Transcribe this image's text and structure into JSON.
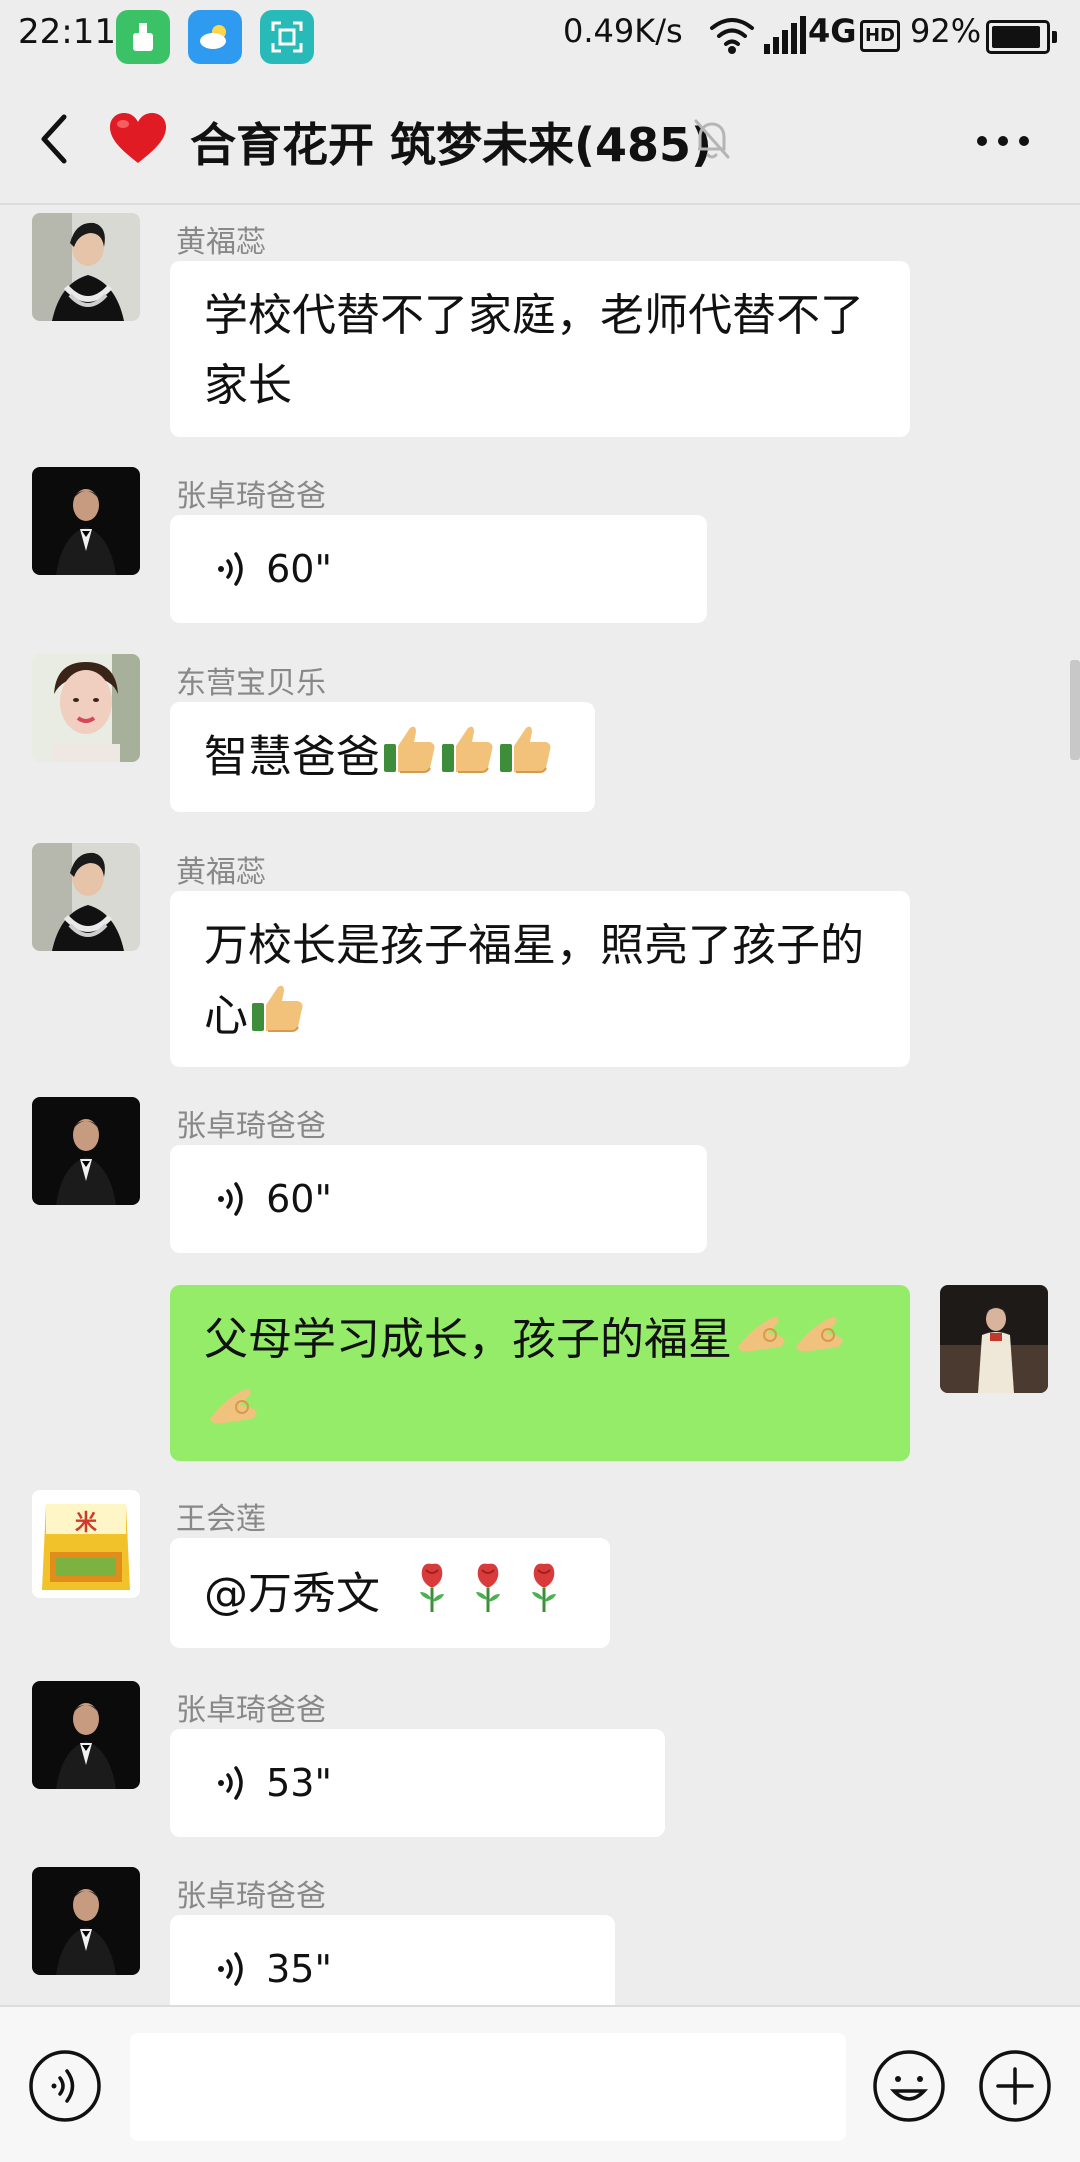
{
  "status_bar": {
    "time": "22:11",
    "net_speed": "0.49K/s",
    "network": "4G",
    "hd": "HD",
    "battery": "92%",
    "battery_level": 0.92,
    "icons": [
      "cleaner-app-icon",
      "weather-app-icon",
      "scanner-app-icon",
      "wifi-icon",
      "signal-icon",
      "battery-icon"
    ]
  },
  "header": {
    "title": "合育花开 筑梦未来(485)",
    "icons": [
      "back-arrow-icon",
      "heart-icon",
      "mute-bell-icon",
      "more-icon"
    ]
  },
  "messages": [
    {
      "sender": "黄福蕊",
      "type": "text",
      "lines": [
        "学校代替不了家庭，老师代替不了",
        "家长"
      ]
    },
    {
      "sender": "张卓琦爸爸",
      "type": "voice",
      "duration": "60\""
    },
    {
      "sender": "东营宝贝乐",
      "type": "text",
      "lines": [
        "智慧爸爸"
      ],
      "emoji": "thumbs-up-icon"
    },
    {
      "sender": "黄福蕊",
      "type": "text",
      "lines": [
        "万校长是孩子福星，照亮了孩子的",
        "心"
      ],
      "emoji": "thumbs-up-icon"
    },
    {
      "sender": "张卓琦爸爸",
      "type": "voice",
      "duration": "60\""
    },
    {
      "sender": "",
      "type": "text",
      "self": true,
      "lines": [
        "父母学习成长，孩子的福星"
      ],
      "emoji": "ok-hand-icon"
    },
    {
      "sender": "王会莲",
      "type": "text",
      "lines": [
        "@万秀文"
      ],
      "emoji": "rose-icon"
    },
    {
      "sender": "张卓琦爸爸",
      "type": "voice",
      "duration": "53\""
    },
    {
      "sender": "张卓琦爸爸",
      "type": "voice",
      "duration": "35\""
    }
  ],
  "input_bar": {
    "placeholder": "",
    "icons": [
      "voice-toggle-icon",
      "emoji-icon",
      "plus-icon"
    ]
  },
  "colors": {
    "background": "#ededed",
    "bubble_other": "#ffffff",
    "bubble_self": "#95ec69",
    "sender_name": "#888888"
  }
}
